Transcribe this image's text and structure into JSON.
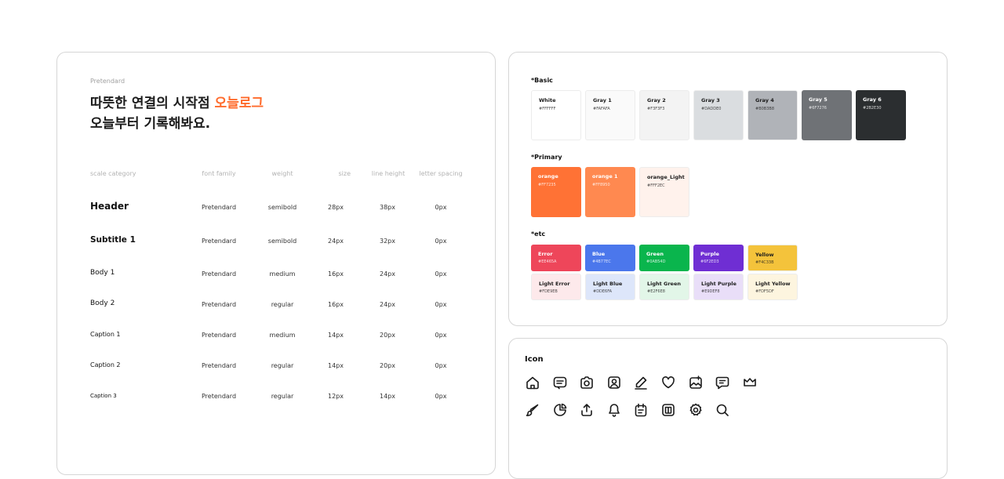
{
  "typography": {
    "font_name": "Pretendard",
    "headline_line1": "따뜻한 연결의 시작점 ",
    "headline_accent": "오늘로그",
    "headline_line2": "오늘부터 기록해봐요.",
    "columns": [
      "scale category",
      "font family",
      "weight",
      "size",
      "line height",
      "letter spacing"
    ],
    "rows": [
      {
        "category": "Header",
        "family": "Pretendard",
        "weight": "semibold",
        "size": "28px",
        "line_height": "38px",
        "letter_spacing": "0px"
      },
      {
        "category": "Subtitle 1",
        "family": "Pretendard",
        "weight": "semibold",
        "size": "24px",
        "line_height": "32px",
        "letter_spacing": "0px"
      },
      {
        "category": "Body 1",
        "family": "Pretendard",
        "weight": "medium",
        "size": "16px",
        "line_height": "24px",
        "letter_spacing": "0px"
      },
      {
        "category": "Body 2",
        "family": "Pretendard",
        "weight": "regular",
        "size": "16px",
        "line_height": "24px",
        "letter_spacing": "0px"
      },
      {
        "category": "Caption 1",
        "family": "Pretendard",
        "weight": "medium",
        "size": "14px",
        "line_height": "20px",
        "letter_spacing": "0px"
      },
      {
        "category": "Caption 2",
        "family": "Pretendard",
        "weight": "regular",
        "size": "14px",
        "line_height": "20px",
        "letter_spacing": "0px"
      },
      {
        "category": "Caption 3",
        "family": "Pretendard",
        "weight": "regular",
        "size": "12px",
        "line_height": "14px",
        "letter_spacing": "0px"
      }
    ]
  },
  "colors": {
    "basic_label": "*Basic",
    "basic": [
      {
        "name": "White",
        "hex": "#FFFFFF"
      },
      {
        "name": "Gray 1",
        "hex": "#FAFAFA"
      },
      {
        "name": "Gray 2",
        "hex": "#F3F3F3"
      },
      {
        "name": "Gray 3",
        "hex": "#DADDE0"
      },
      {
        "name": "Gray 4",
        "hex": "#B0B3B8"
      },
      {
        "name": "Gray 5",
        "hex": "#6F7276"
      },
      {
        "name": "Gray 6",
        "hex": "#2B2E30"
      }
    ],
    "primary_label": "*Primary",
    "primary": [
      {
        "name": "orange",
        "hex": "#FF7235"
      },
      {
        "name": "orange 1",
        "hex": "#FF8950"
      },
      {
        "name": "orange_Light",
        "hex": "#FFF2EC"
      }
    ],
    "etc_label": "*etc",
    "etc": [
      {
        "name": "Error",
        "hex": "#EE465A"
      },
      {
        "name": "Blue",
        "hex": "#4B77EC"
      },
      {
        "name": "Green",
        "hex": "#0AB54D"
      },
      {
        "name": "Purple",
        "hex": "#6F2ED3"
      },
      {
        "name": "Yellow",
        "hex": "#F4C33B"
      }
    ],
    "etc_light": [
      {
        "name": "Light Error",
        "hex": "#FDE9EB"
      },
      {
        "name": "Light Blue",
        "hex": "#DDE6FA"
      },
      {
        "name": "Light Green",
        "hex": "#E2F6E8"
      },
      {
        "name": "Light Purple",
        "hex": "#E9DEF8"
      },
      {
        "name": "Light Yellow",
        "hex": "#FDF5DF"
      }
    ]
  },
  "icons": {
    "title": "Icon",
    "row1": [
      "home-icon",
      "message-box-icon",
      "camera-icon",
      "user-profile-icon",
      "edit-pencil-icon",
      "heart-icon",
      "image-add-icon",
      "chat-bubble-icon",
      "crown-icon"
    ],
    "row2": [
      "brush-icon",
      "pie-chart-icon",
      "share-upload-icon",
      "bell-icon",
      "calendar-icon",
      "book-icon",
      "settings-gear-icon",
      "search-icon"
    ]
  }
}
